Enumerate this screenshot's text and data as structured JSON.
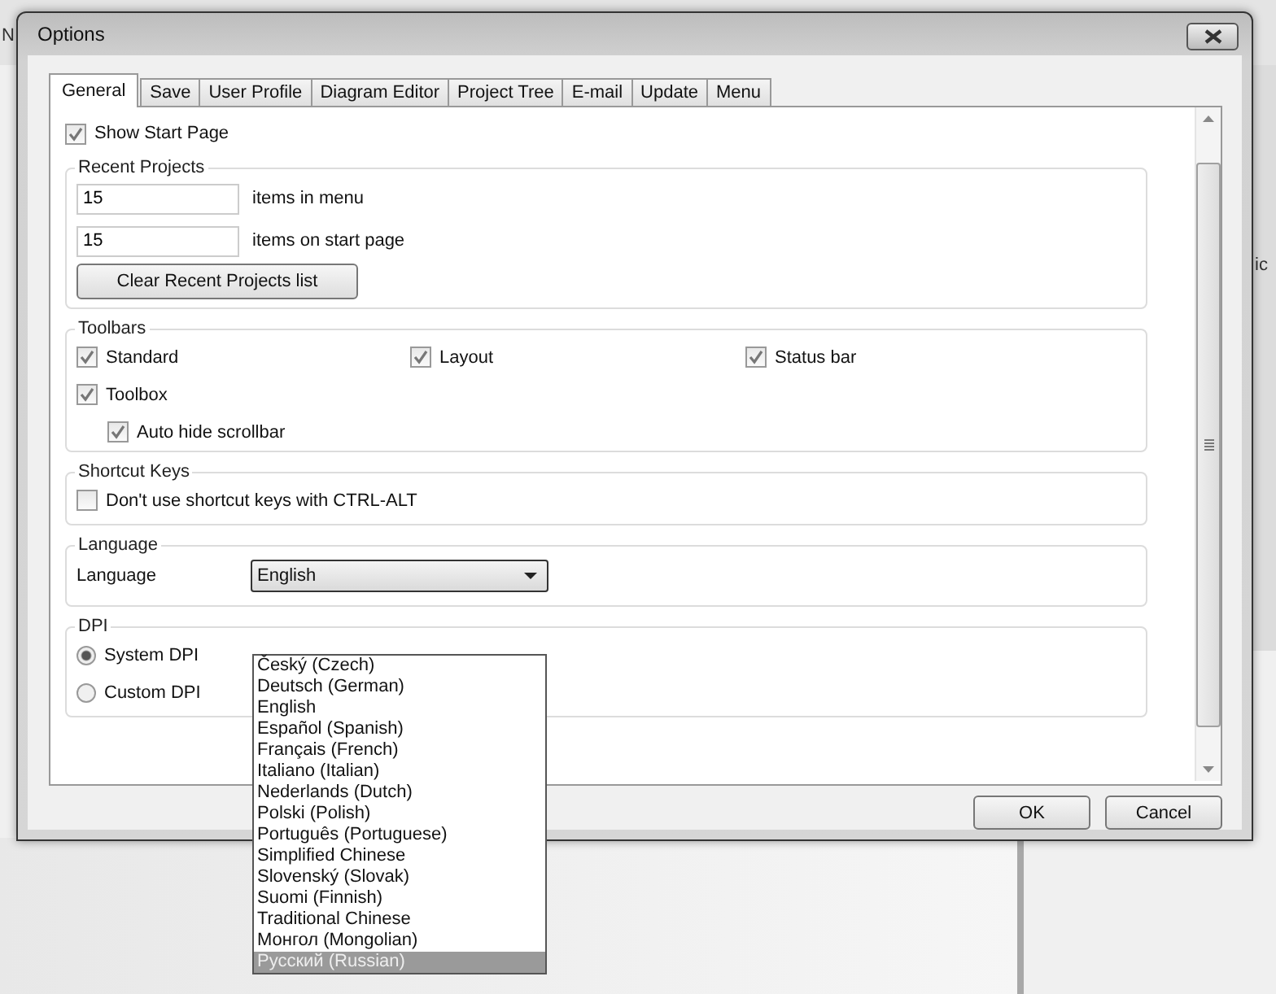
{
  "background": {
    "texts": [
      "N",
      "ic"
    ]
  },
  "window": {
    "title": "Options"
  },
  "tabs": [
    {
      "label": "General",
      "selected": true
    },
    {
      "label": "Save",
      "selected": false
    },
    {
      "label": "User Profile",
      "selected": false
    },
    {
      "label": "Diagram Editor",
      "selected": false
    },
    {
      "label": "Project Tree",
      "selected": false
    },
    {
      "label": "E-mail",
      "selected": false
    },
    {
      "label": "Update",
      "selected": false
    },
    {
      "label": "Menu",
      "selected": false
    }
  ],
  "show_start_page": {
    "label": "Show Start Page",
    "checked": true
  },
  "recent_projects": {
    "title": "Recent Projects",
    "fields": [
      {
        "value": "15",
        "label": "items in menu"
      },
      {
        "value": "15",
        "label": "items on start page"
      }
    ],
    "button": "Clear Recent Projects list"
  },
  "toolbars": {
    "title": "Toolbars",
    "options": [
      {
        "label": "Standard",
        "checked": true
      },
      {
        "label": "Layout",
        "checked": true
      },
      {
        "label": "Status bar",
        "checked": true
      },
      {
        "label": "Toolbox",
        "checked": true,
        "children": [
          {
            "label": "Auto hide scrollbar",
            "checked": true
          }
        ]
      }
    ]
  },
  "shortcut_keys": {
    "title": "Shortcut Keys",
    "option": {
      "label": "Don't use shortcut keys with CTRL-ALT",
      "checked": false
    }
  },
  "language": {
    "title": "Language",
    "label": "Language",
    "value": "English",
    "expanded": true,
    "options": [
      {
        "label": "Český (Czech)",
        "highlighted": false
      },
      {
        "label": "Deutsch (German)",
        "highlighted": false
      },
      {
        "label": "English",
        "highlighted": false
      },
      {
        "label": "Español (Spanish)",
        "highlighted": false
      },
      {
        "label": "Français (French)",
        "highlighted": false
      },
      {
        "label": "Italiano (Italian)",
        "highlighted": false
      },
      {
        "label": "Nederlands (Dutch)",
        "highlighted": false
      },
      {
        "label": "Polski (Polish)",
        "highlighted": false
      },
      {
        "label": "Português (Portuguese)",
        "highlighted": false
      },
      {
        "label": "Simplified Chinese",
        "highlighted": false
      },
      {
        "label": "Slovenský (Slovak)",
        "highlighted": false
      },
      {
        "label": "Suomi (Finnish)",
        "highlighted": false
      },
      {
        "label": "Traditional Chinese",
        "highlighted": false
      },
      {
        "label": "Монгол (Mongolian)",
        "highlighted": false
      },
      {
        "label": "Русский (Russian)",
        "highlighted": true
      }
    ]
  },
  "dpi": {
    "title": "DPI",
    "options": [
      {
        "label": "System DPI",
        "selected": true
      },
      {
        "label": "Custom DPI",
        "selected": false
      }
    ]
  },
  "buttons": [
    "OK",
    "Cancel"
  ]
}
